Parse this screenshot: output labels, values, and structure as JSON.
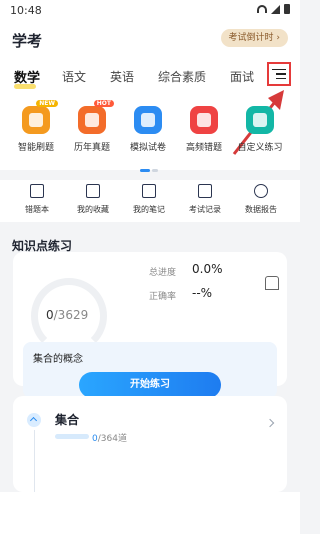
{
  "status": {
    "time": "10:48"
  },
  "header": {
    "title": "学考",
    "countdown_label": "考试倒计时 ›"
  },
  "tabs": [
    {
      "label": "数学",
      "active": true
    },
    {
      "label": "语文"
    },
    {
      "label": "英语"
    },
    {
      "label": "综合素质"
    },
    {
      "label": "面试"
    }
  ],
  "features": [
    {
      "label": "智能刷题",
      "color": "#f49a1f",
      "badge": "NEW"
    },
    {
      "label": "历年真题",
      "color": "#f36c2a",
      "badge": "HOT"
    },
    {
      "label": "模拟试卷",
      "color": "#2c8cf2",
      "badge": ""
    },
    {
      "label": "高频错题",
      "color": "#ef4343",
      "badge": ""
    },
    {
      "label": "自定义练习",
      "color": "#13b7a6",
      "badge": ""
    }
  ],
  "tools": [
    {
      "label": "错题本"
    },
    {
      "label": "我的收藏"
    },
    {
      "label": "我的笔记"
    },
    {
      "label": "考试记录"
    },
    {
      "label": "数据报告"
    }
  ],
  "practice": {
    "section_title": "知识点练习",
    "done": "0",
    "total": "/3629",
    "progress_label": "总进度",
    "progress_value": "0.0%",
    "accuracy_label": "正确率",
    "accuracy_value": "--%",
    "concept_title": "集合的概念",
    "start_label": "开始练习"
  },
  "chapter": {
    "title": "集合",
    "done": "0",
    "total": "/364道",
    "progress": 0
  },
  "colors": {
    "accent": "#1e7cf0",
    "highlight": "#e53a3a"
  }
}
